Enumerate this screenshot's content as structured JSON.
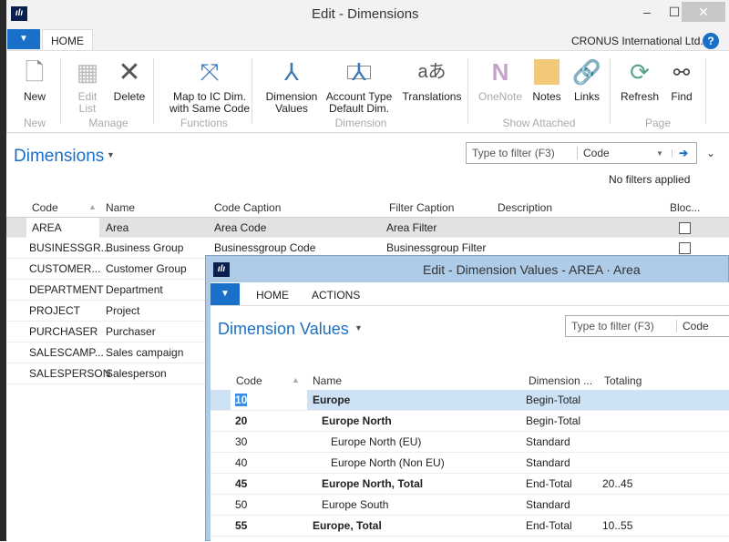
{
  "main": {
    "title": "Edit - Dimensions",
    "window_controls": {
      "minimize": "–",
      "maximize": "☐",
      "close": "✕"
    },
    "tabs": [
      {
        "label": "HOME"
      }
    ],
    "company": "CRONUS International Ltd.",
    "help": "?",
    "ribbon": {
      "buttons": [
        {
          "label": "New",
          "icon": "new-document-icon",
          "enabled": true
        },
        {
          "label": "Edit List",
          "icon": "edit-list-icon",
          "enabled": false
        },
        {
          "label": "Delete",
          "icon": "delete-icon",
          "enabled": true
        },
        {
          "label": "Map to IC Dim. with Same Code",
          "icon": "map-dimension-icon",
          "enabled": true
        },
        {
          "label": "Dimension Values",
          "icon": "dimension-icon",
          "enabled": true
        },
        {
          "label": "Account Type Default Dim.",
          "icon": "account-type-dimension-icon",
          "enabled": true
        },
        {
          "label": "Translations",
          "icon": "translations-icon",
          "enabled": true
        },
        {
          "label": "OneNote",
          "icon": "onenote-icon",
          "enabled": false
        },
        {
          "label": "Notes",
          "icon": "notes-icon",
          "enabled": true
        },
        {
          "label": "Links",
          "icon": "links-icon",
          "enabled": true
        },
        {
          "label": "Refresh",
          "icon": "refresh-icon",
          "enabled": true
        },
        {
          "label": "Find",
          "icon": "binoculars-icon",
          "enabled": true
        }
      ],
      "groups": [
        "New",
        "Manage",
        "Functions",
        "Dimension",
        "Show Attached",
        "Page"
      ]
    },
    "page_title": "Dimensions",
    "filter": {
      "placeholder": "Type to filter (F3)",
      "field": "Code",
      "status": "No filters applied"
    },
    "columns": [
      "Code",
      "Name",
      "Code Caption",
      "Filter Caption",
      "Description",
      "Bloc..."
    ],
    "rows": [
      {
        "code": "AREA",
        "name": "Area",
        "code_caption": "Area Code",
        "filter_caption": "Area Filter",
        "description": "",
        "blocked": false
      },
      {
        "code": "BUSINESSGR...",
        "name": "Business Group",
        "code_caption": "Businessgroup Code",
        "filter_caption": "Businessgroup Filter",
        "description": "",
        "blocked": false
      },
      {
        "code": "CUSTOMER...",
        "name": "Customer Group"
      },
      {
        "code": "DEPARTMENT",
        "name": "Department"
      },
      {
        "code": "PROJECT",
        "name": "Project"
      },
      {
        "code": "PURCHASER",
        "name": "Purchaser"
      },
      {
        "code": "SALESCAMP...",
        "name": "Sales campaign"
      },
      {
        "code": "SALESPERSON",
        "name": "Salesperson"
      }
    ]
  },
  "child": {
    "title": "Edit - Dimension Values - AREA · Area",
    "tabs": [
      {
        "label": "HOME"
      },
      {
        "label": "ACTIONS"
      }
    ],
    "page_title": "Dimension Values",
    "filter": {
      "placeholder": "Type to filter (F3)",
      "field": "Code"
    },
    "columns": [
      "Code",
      "Name",
      "Dimension ...",
      "Totaling"
    ],
    "rows": [
      {
        "code": "10",
        "name": "Europe",
        "type": "Begin-Total",
        "totaling": "",
        "bold": true,
        "indent": 0
      },
      {
        "code": "20",
        "name": "Europe North",
        "type": "Begin-Total",
        "totaling": "",
        "bold": true,
        "indent": 1
      },
      {
        "code": "30",
        "name": "Europe North (EU)",
        "type": "Standard",
        "totaling": "",
        "bold": false,
        "indent": 2
      },
      {
        "code": "40",
        "name": "Europe North (Non EU)",
        "type": "Standard",
        "totaling": "",
        "bold": false,
        "indent": 2
      },
      {
        "code": "45",
        "name": "Europe North, Total",
        "type": "End-Total",
        "totaling": "20..45",
        "bold": true,
        "indent": 1
      },
      {
        "code": "50",
        "name": "Europe South",
        "type": "Standard",
        "totaling": "",
        "bold": false,
        "indent": 1
      },
      {
        "code": "55",
        "name": "Europe, Total",
        "type": "End-Total",
        "totaling": "10..55",
        "bold": true,
        "indent": 0
      }
    ]
  }
}
